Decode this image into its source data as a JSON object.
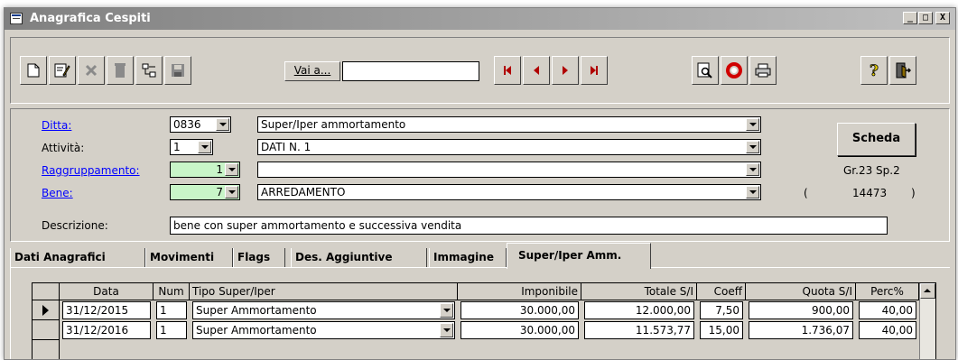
{
  "window": {
    "title": "Anagrafica Cespiti",
    "min_label": "_",
    "max_label": "□",
    "close_label": "X"
  },
  "toolbar": {
    "buttons": [
      {
        "icon": "new-document-icon"
      },
      {
        "icon": "edit-icon"
      },
      {
        "icon": "delete-x-icon"
      },
      {
        "icon": "trash-icon"
      },
      {
        "icon": "tree-structure-icon"
      },
      {
        "icon": "save-floppy-icon"
      },
      {
        "icon": "first-record-icon"
      },
      {
        "icon": "previous-record-icon"
      },
      {
        "icon": "next-record-icon"
      },
      {
        "icon": "last-record-icon"
      },
      {
        "icon": "print-preview-icon"
      },
      {
        "icon": "refresh-icon"
      },
      {
        "icon": "print-icon"
      },
      {
        "icon": "help-icon"
      },
      {
        "icon": "exit-icon"
      }
    ],
    "goto_label": "Vai a...",
    "goto_value": ""
  },
  "form": {
    "ditta": {
      "label": "Ditta:",
      "code": "0836",
      "name": "Super/Iper ammortamento"
    },
    "attivita": {
      "label": "Attività:",
      "code": "1",
      "name": "DATI N.  1"
    },
    "raggruppamento": {
      "label": "Raggruppamento:",
      "code": "1",
      "name": ""
    },
    "bene": {
      "label": "Bene:",
      "code": "7",
      "name": "ARREDAMENTO"
    },
    "descrizione": {
      "label": "Descrizione:",
      "value": "bene con super ammortamento e successiva vendita"
    },
    "scheda_label": "Scheda",
    "group_info": "Gr.23 Sp.2",
    "record_open": "(",
    "record_id": "14473",
    "record_close": ")"
  },
  "tabs": [
    {
      "label": "Dati Anagrafici"
    },
    {
      "label": "Movimenti"
    },
    {
      "label": "Flags"
    },
    {
      "label": "Des. Aggiuntive"
    },
    {
      "label": "Immagine"
    },
    {
      "label": "Super/Iper Amm."
    }
  ],
  "grid": {
    "columns": [
      "Data",
      "Num",
      "Tipo Super/Iper",
      "Imponibile",
      "Totale S/I",
      "Coeff",
      "Quota S/I",
      "Perc%"
    ],
    "rows": [
      {
        "data": "31/12/2015",
        "num": "1",
        "tipo": "Super Ammortamento",
        "imponibile": "30.000,00",
        "totale": "12.000,00",
        "coeff": "7,50",
        "quota": "900,00",
        "perc": "40,00"
      },
      {
        "data": "31/12/2016",
        "num": "1",
        "tipo": "Super Ammortamento",
        "imponibile": "30.000,00",
        "totale": "11.573,77",
        "coeff": "15,00",
        "quota": "1.736,07",
        "perc": "40,00"
      }
    ]
  },
  "colors": {
    "green_field": "#c8f5c8",
    "link": "#0000ff",
    "nav_red": "#b00000",
    "face": "#d4d0c8"
  }
}
